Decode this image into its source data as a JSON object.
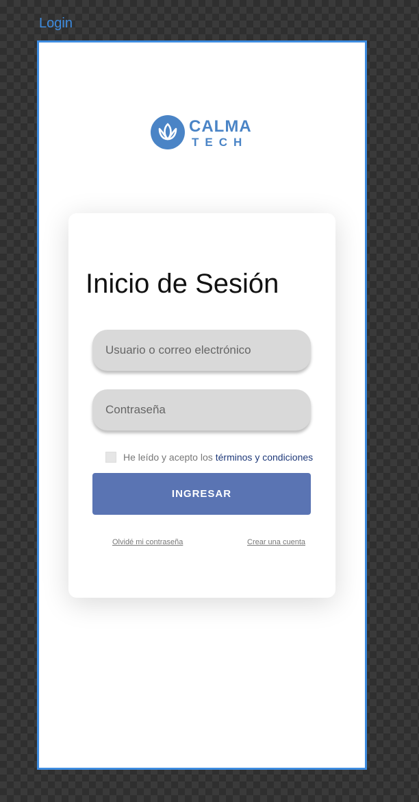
{
  "canvas": {
    "frame_label": "Login"
  },
  "logo": {
    "icon": "lotus-icon",
    "line1": "CALMA",
    "line2": "TECH",
    "color": "#4a84c6"
  },
  "login_card": {
    "title": "Inicio de Sesión",
    "username_placeholder": "Usuario o correo electrónico",
    "password_placeholder": "Contraseña",
    "terms_prefix": "He leído y acepto los",
    "terms_link": "términos y condiciones",
    "submit_label": "INGRESAR",
    "forgot_password": "Olvidé mi contraseña",
    "create_account": "Crear una cuenta"
  },
  "colors": {
    "frame_border": "#3d8bdf",
    "button": "#5a74b3",
    "field_bg": "#d9d9d9",
    "link": "#1f3a7a"
  }
}
